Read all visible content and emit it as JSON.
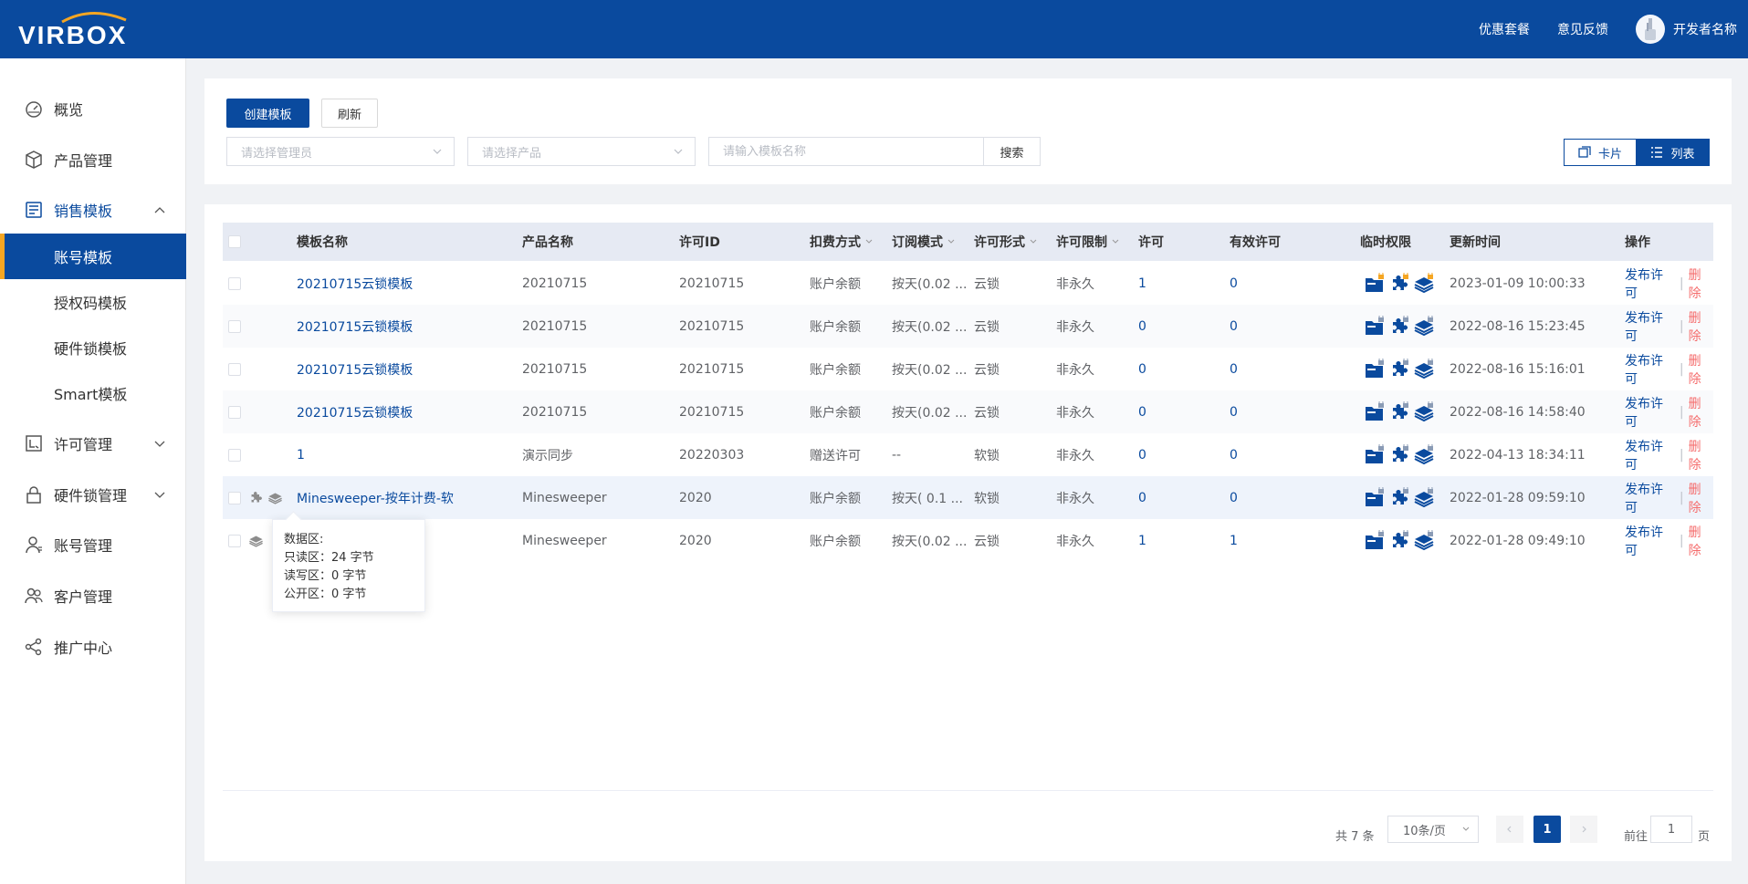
{
  "header": {
    "brand": "VIRBOX",
    "links": [
      "优惠套餐",
      "意见反馈"
    ],
    "developer": "开发者名称"
  },
  "sidebar": {
    "items": [
      {
        "label": "概览",
        "icon": "dashboard-icon"
      },
      {
        "label": "产品管理",
        "icon": "cube-icon"
      },
      {
        "label": "销售模板",
        "icon": "template-icon",
        "open": true
      },
      {
        "label": "许可管理",
        "icon": "license-icon"
      },
      {
        "label": "硬件锁管理",
        "icon": "lock-icon"
      },
      {
        "label": "账号管理",
        "icon": "user-icon"
      },
      {
        "label": "客户管理",
        "icon": "customers-icon"
      },
      {
        "label": "推广中心",
        "icon": "share-icon"
      }
    ],
    "subitems": [
      "账号模板",
      "授权码模板",
      "硬件锁模板",
      "Smart模板"
    ],
    "active_subitem": "账号模板"
  },
  "toolbar": {
    "create_label": "创建模板",
    "refresh_label": "刷新",
    "manager_placeholder": "请选择管理员",
    "product_placeholder": "请选择产品",
    "name_placeholder": "请输入模板名称",
    "search_label": "搜索",
    "view_card": "卡片",
    "view_list": "列表",
    "active_view": "列表"
  },
  "table": {
    "columns": [
      "模板名称",
      "产品名称",
      "许可ID",
      "扣费方式",
      "订阅模式",
      "许可形式",
      "许可限制",
      "许可",
      "有效许可",
      "临时权限",
      "更新时间",
      "操作"
    ],
    "rows": [
      {
        "name": "20210715云锁模板",
        "product": "20210715",
        "license_id": "20210715",
        "billing": "账户余额",
        "subscription": "按天(0.02 ...",
        "form": "云锁",
        "limit": "非永久",
        "licenses": "1",
        "valid": "0",
        "updated": "2023-01-09 10:00:33"
      },
      {
        "name": "20210715云锁模板",
        "product": "20210715",
        "license_id": "20210715",
        "billing": "账户余额",
        "subscription": "按天(0.02 ...",
        "form": "云锁",
        "limit": "非永久",
        "licenses": "0",
        "valid": "0",
        "updated": "2022-08-16 15:23:45"
      },
      {
        "name": "20210715云锁模板",
        "product": "20210715",
        "license_id": "20210715",
        "billing": "账户余额",
        "subscription": "按天(0.02 ...",
        "form": "云锁",
        "limit": "非永久",
        "licenses": "0",
        "valid": "0",
        "updated": "2022-08-16 15:16:01"
      },
      {
        "name": "20210715云锁模板",
        "product": "20210715",
        "license_id": "20210715",
        "billing": "账户余额",
        "subscription": "按天(0.02 ...",
        "form": "云锁",
        "limit": "非永久",
        "licenses": "0",
        "valid": "0",
        "updated": "2022-08-16 14:58:40"
      },
      {
        "name": "1",
        "product": "演示同步",
        "license_id": "20220303",
        "billing": "赠送许可",
        "subscription": "--",
        "form": "软锁",
        "limit": "非永久",
        "licenses": "0",
        "valid": "0",
        "updated": "2022-04-13 18:34:11"
      },
      {
        "name": "Minesweeper-按年计费-软",
        "product": "Minesweeper",
        "license_id": "2020",
        "billing": "账户余额",
        "subscription": "按天( 0.1 ...",
        "form": "软锁",
        "limit": "非永久",
        "licenses": "0",
        "valid": "0",
        "updated": "2022-01-28 09:59:10"
      },
      {
        "name": "",
        "product": "Minesweeper",
        "license_id": "2020",
        "billing": "账户余额",
        "subscription": "按天(0.02 ...",
        "form": "云锁",
        "limit": "非永久",
        "licenses": "1",
        "valid": "1",
        "updated": "2022-01-28 09:49:10"
      }
    ],
    "op_publish": "发布许可",
    "op_delete": "删除",
    "op_sep": "|"
  },
  "tooltip": {
    "lines": [
      "数据区:",
      "只读区：24 字节",
      "读写区：0 字节",
      "公开区：0 字节"
    ]
  },
  "pagination": {
    "total": "共 7 条",
    "page_size": "10条/页",
    "current": "1",
    "goto_prefix": "前往",
    "goto_value": "1",
    "goto_suffix": "页"
  },
  "colors": {
    "primary": "#0a4a9e",
    "accent": "#f5a623",
    "danger": "#f56c6c"
  }
}
